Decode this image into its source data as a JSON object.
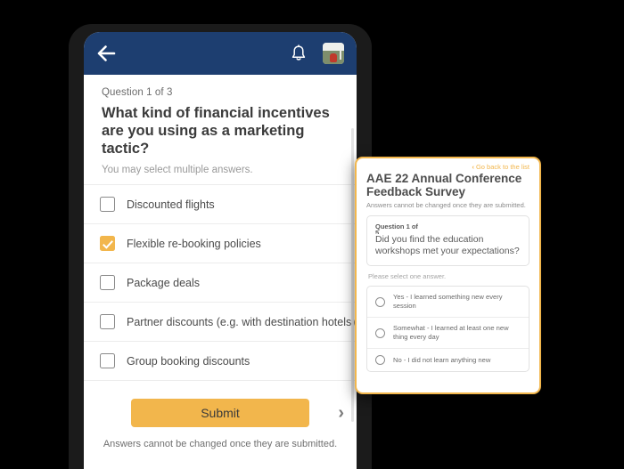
{
  "phone": {
    "appbar": {
      "back_icon": "arrow-left-icon",
      "bell_icon": "notification-bell-icon",
      "avatar_icon": "user-avatar-photo"
    },
    "question": {
      "meta": "Question 1 of 3",
      "title": "What kind of financial incentives are you using as a marketing tactic?",
      "hint": "You may select multiple answers.",
      "options": [
        {
          "label": "Discounted flights",
          "checked": false
        },
        {
          "label": "Flexible re-booking policies",
          "checked": true
        },
        {
          "label": "Package deals",
          "checked": false
        },
        {
          "label": "Partner discounts (e.g. with destination hotels)",
          "checked": false
        },
        {
          "label": "Group booking discounts",
          "checked": false
        }
      ]
    },
    "submit_label": "Submit",
    "next_icon": "chevron-right-icon",
    "footnote": "Answers cannot be changed once they are submitted."
  },
  "inset": {
    "go_back_label": "Go back to the list",
    "go_back_icon": "chevron-left-icon",
    "title": "AAE 22 Annual Conference Feedback Survey",
    "subtitle": "Answers cannot be changed once they are submitted.",
    "question_meta": "Question 1 of",
    "question_number": "5",
    "question_text": "Did you find the education workshops met your expectations?",
    "hint": "Please select one answer.",
    "options": [
      "Yes - I learned something new every session",
      "Somewhat - I learned at least one new thing every day",
      "No - I did not learn anything new"
    ]
  },
  "colors": {
    "navy": "#1D3E70",
    "accent_orange": "#F2B64C",
    "background": "#000000"
  }
}
